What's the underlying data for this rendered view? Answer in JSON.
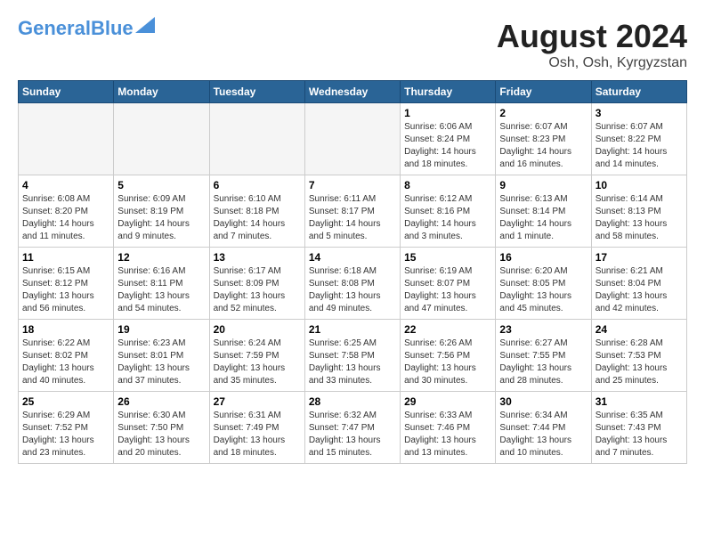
{
  "header": {
    "logo_line1": "General",
    "logo_line2": "Blue",
    "month_title": "August 2024",
    "location": "Osh, Osh, Kyrgyzstan"
  },
  "weekdays": [
    "Sunday",
    "Monday",
    "Tuesday",
    "Wednesday",
    "Thursday",
    "Friday",
    "Saturday"
  ],
  "weeks": [
    [
      {
        "day": "",
        "info": ""
      },
      {
        "day": "",
        "info": ""
      },
      {
        "day": "",
        "info": ""
      },
      {
        "day": "",
        "info": ""
      },
      {
        "day": "1",
        "info": "Sunrise: 6:06 AM\nSunset: 8:24 PM\nDaylight: 14 hours\nand 18 minutes."
      },
      {
        "day": "2",
        "info": "Sunrise: 6:07 AM\nSunset: 8:23 PM\nDaylight: 14 hours\nand 16 minutes."
      },
      {
        "day": "3",
        "info": "Sunrise: 6:07 AM\nSunset: 8:22 PM\nDaylight: 14 hours\nand 14 minutes."
      }
    ],
    [
      {
        "day": "4",
        "info": "Sunrise: 6:08 AM\nSunset: 8:20 PM\nDaylight: 14 hours\nand 11 minutes."
      },
      {
        "day": "5",
        "info": "Sunrise: 6:09 AM\nSunset: 8:19 PM\nDaylight: 14 hours\nand 9 minutes."
      },
      {
        "day": "6",
        "info": "Sunrise: 6:10 AM\nSunset: 8:18 PM\nDaylight: 14 hours\nand 7 minutes."
      },
      {
        "day": "7",
        "info": "Sunrise: 6:11 AM\nSunset: 8:17 PM\nDaylight: 14 hours\nand 5 minutes."
      },
      {
        "day": "8",
        "info": "Sunrise: 6:12 AM\nSunset: 8:16 PM\nDaylight: 14 hours\nand 3 minutes."
      },
      {
        "day": "9",
        "info": "Sunrise: 6:13 AM\nSunset: 8:14 PM\nDaylight: 14 hours\nand 1 minute."
      },
      {
        "day": "10",
        "info": "Sunrise: 6:14 AM\nSunset: 8:13 PM\nDaylight: 13 hours\nand 58 minutes."
      }
    ],
    [
      {
        "day": "11",
        "info": "Sunrise: 6:15 AM\nSunset: 8:12 PM\nDaylight: 13 hours\nand 56 minutes."
      },
      {
        "day": "12",
        "info": "Sunrise: 6:16 AM\nSunset: 8:11 PM\nDaylight: 13 hours\nand 54 minutes."
      },
      {
        "day": "13",
        "info": "Sunrise: 6:17 AM\nSunset: 8:09 PM\nDaylight: 13 hours\nand 52 minutes."
      },
      {
        "day": "14",
        "info": "Sunrise: 6:18 AM\nSunset: 8:08 PM\nDaylight: 13 hours\nand 49 minutes."
      },
      {
        "day": "15",
        "info": "Sunrise: 6:19 AM\nSunset: 8:07 PM\nDaylight: 13 hours\nand 47 minutes."
      },
      {
        "day": "16",
        "info": "Sunrise: 6:20 AM\nSunset: 8:05 PM\nDaylight: 13 hours\nand 45 minutes."
      },
      {
        "day": "17",
        "info": "Sunrise: 6:21 AM\nSunset: 8:04 PM\nDaylight: 13 hours\nand 42 minutes."
      }
    ],
    [
      {
        "day": "18",
        "info": "Sunrise: 6:22 AM\nSunset: 8:02 PM\nDaylight: 13 hours\nand 40 minutes."
      },
      {
        "day": "19",
        "info": "Sunrise: 6:23 AM\nSunset: 8:01 PM\nDaylight: 13 hours\nand 37 minutes."
      },
      {
        "day": "20",
        "info": "Sunrise: 6:24 AM\nSunset: 7:59 PM\nDaylight: 13 hours\nand 35 minutes."
      },
      {
        "day": "21",
        "info": "Sunrise: 6:25 AM\nSunset: 7:58 PM\nDaylight: 13 hours\nand 33 minutes."
      },
      {
        "day": "22",
        "info": "Sunrise: 6:26 AM\nSunset: 7:56 PM\nDaylight: 13 hours\nand 30 minutes."
      },
      {
        "day": "23",
        "info": "Sunrise: 6:27 AM\nSunset: 7:55 PM\nDaylight: 13 hours\nand 28 minutes."
      },
      {
        "day": "24",
        "info": "Sunrise: 6:28 AM\nSunset: 7:53 PM\nDaylight: 13 hours\nand 25 minutes."
      }
    ],
    [
      {
        "day": "25",
        "info": "Sunrise: 6:29 AM\nSunset: 7:52 PM\nDaylight: 13 hours\nand 23 minutes."
      },
      {
        "day": "26",
        "info": "Sunrise: 6:30 AM\nSunset: 7:50 PM\nDaylight: 13 hours\nand 20 minutes."
      },
      {
        "day": "27",
        "info": "Sunrise: 6:31 AM\nSunset: 7:49 PM\nDaylight: 13 hours\nand 18 minutes."
      },
      {
        "day": "28",
        "info": "Sunrise: 6:32 AM\nSunset: 7:47 PM\nDaylight: 13 hours\nand 15 minutes."
      },
      {
        "day": "29",
        "info": "Sunrise: 6:33 AM\nSunset: 7:46 PM\nDaylight: 13 hours\nand 13 minutes."
      },
      {
        "day": "30",
        "info": "Sunrise: 6:34 AM\nSunset: 7:44 PM\nDaylight: 13 hours\nand 10 minutes."
      },
      {
        "day": "31",
        "info": "Sunrise: 6:35 AM\nSunset: 7:43 PM\nDaylight: 13 hours\nand 7 minutes."
      }
    ]
  ]
}
